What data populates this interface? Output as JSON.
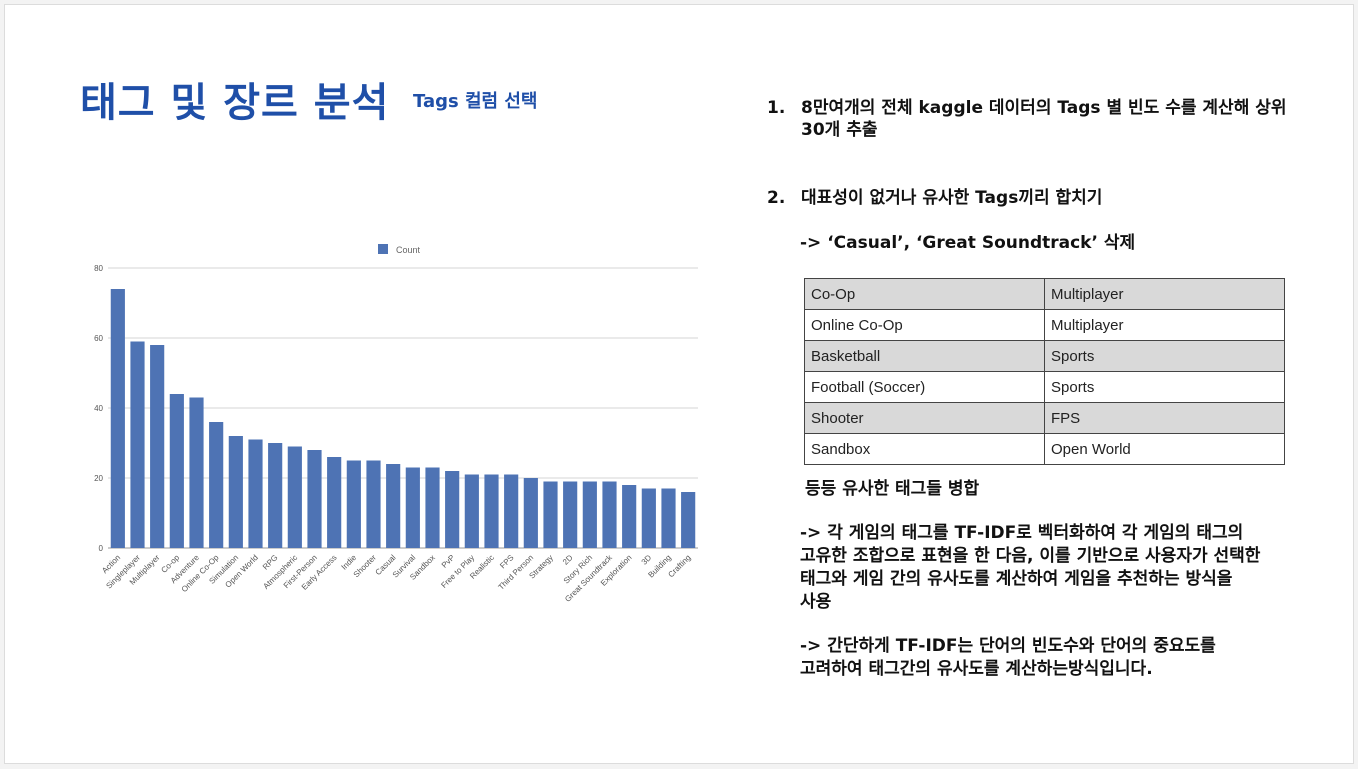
{
  "slide": {
    "title": "태그 및 장르 분석",
    "subtitle": "Tags 컬럼 선택",
    "accent_color": "#1f4fa8",
    "bar_color": "#4e73b4"
  },
  "chart_data": {
    "type": "bar",
    "title": "",
    "xlabel": "",
    "ylabel": "",
    "ylim": [
      0,
      80
    ],
    "yticks": [
      0,
      20,
      40,
      60,
      80
    ],
    "legend": "top-center",
    "grid": true,
    "series": [
      {
        "name": "Count",
        "values": [
          74,
          59,
          58,
          44,
          43,
          36,
          32,
          31,
          30,
          29,
          28,
          26,
          25,
          25,
          24,
          23,
          23,
          22,
          21,
          21,
          21,
          20,
          19,
          19,
          19,
          19,
          18,
          17,
          17,
          16
        ]
      }
    ],
    "categories": [
      "Action",
      "Singleplayer",
      "Multiplayer",
      "Co-op",
      "Adventure",
      "Online Co-Op",
      "Simulation",
      "Open World",
      "RPG",
      "Atmospheric",
      "First-Person",
      "Early Access",
      "Indie",
      "Shooter",
      "Casual",
      "Survival",
      "Sandbox",
      "PvP",
      "Free to Play",
      "Realistic",
      "FPS",
      "Third Person",
      "Strategy",
      "2D",
      "Story Rich",
      "Great Soundtrack",
      "Exploration",
      "3D",
      "Building",
      "Crafting"
    ]
  },
  "list": [
    {
      "num": "1.",
      "lines": [
        "8만여개의 전체 kaggle 데이터의 Tags 별 빈도 수를 계산해 상위",
        "30개 추출"
      ]
    },
    {
      "num": "2.",
      "lines": [
        "대표성이 없거나 유사한 Tags끼리 합치기"
      ]
    }
  ],
  "delete_note": "-> ‘Casual’, ‘Great Soundtrack’ 삭제",
  "merge_table": [
    [
      "Co-Op",
      "Multiplayer"
    ],
    [
      "Online Co-Op",
      "Multiplayer"
    ],
    [
      "Basketball",
      "Sports"
    ],
    [
      "Football (Soccer)",
      "Sports"
    ],
    [
      "Shooter",
      "FPS"
    ],
    [
      "Sandbox",
      "Open World"
    ]
  ],
  "merge_note": "등등 유사한 태그들 병합",
  "para1": [
    "-> 각 게임의 태그를 TF-IDF로 벡터화하여 각 게임의 태그의",
    "고유한 조합으로 표현을 한 다음, 이를 기반으로 사용자가 선택한",
    "태그와 게임 간의 유사도를 계산하여 게임을 추천하는 방식을",
    "사용"
  ],
  "para2": [
    "-> 간단하게 TF-IDF는 단어의 빈도수와 단어의 중요도를",
    "고려하여 태그간의 유사도를 계산하는방식입니다."
  ]
}
